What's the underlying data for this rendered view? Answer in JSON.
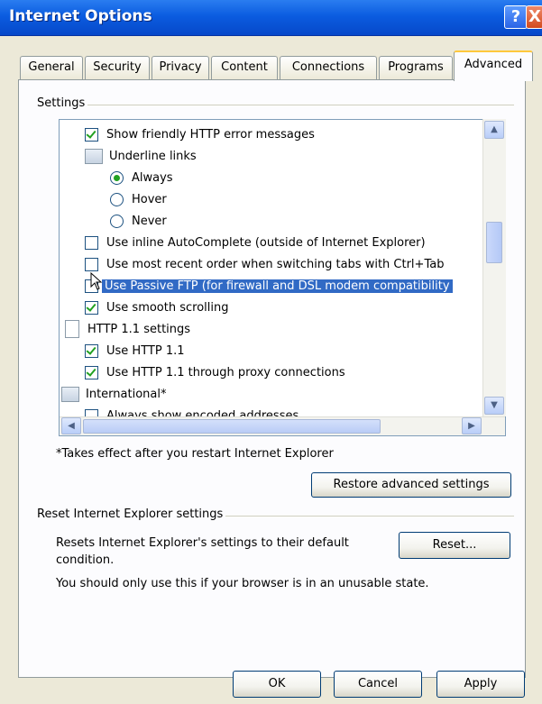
{
  "window": {
    "title": "Internet Options"
  },
  "titlebar_buttons": {
    "help": "?",
    "close": "X"
  },
  "tabs": [
    {
      "label": "General"
    },
    {
      "label": "Security"
    },
    {
      "label": "Privacy"
    },
    {
      "label": "Content"
    },
    {
      "label": "Connections"
    },
    {
      "label": "Programs"
    },
    {
      "label": "Advanced",
      "active": true
    }
  ],
  "settings": {
    "group_label": "Settings",
    "items": [
      {
        "type": "checkbox",
        "checked": true,
        "label": "Show friendly HTTP error messages"
      },
      {
        "type": "category",
        "label": "Underline links"
      },
      {
        "type": "radio",
        "checked": true,
        "label": "Always"
      },
      {
        "type": "radio",
        "checked": false,
        "label": "Hover"
      },
      {
        "type": "radio",
        "checked": false,
        "label": "Never"
      },
      {
        "type": "checkbox",
        "checked": false,
        "label": "Use inline AutoComplete (outside of Internet Explorer)"
      },
      {
        "type": "checkbox",
        "checked": false,
        "label": "Use most recent order when switching tabs with Ctrl+Tab"
      },
      {
        "type": "checkbox",
        "checked": false,
        "selected": true,
        "label": "Use Passive FTP (for firewall and DSL modem compatibility"
      },
      {
        "type": "checkbox",
        "checked": true,
        "label": "Use smooth scrolling"
      },
      {
        "type": "page",
        "label": "HTTP 1.1 settings"
      },
      {
        "type": "checkbox",
        "checked": true,
        "label": "Use HTTP 1.1"
      },
      {
        "type": "checkbox",
        "checked": true,
        "label": "Use HTTP 1.1 through proxy connections"
      },
      {
        "type": "category",
        "label": "International*"
      },
      {
        "type": "checkbox",
        "checked": false,
        "label": "Always show encoded addresses"
      }
    ],
    "footnote": "*Takes effect after you restart Internet Explorer",
    "restore_button": "Restore advanced settings"
  },
  "reset_section": {
    "group_label": "Reset Internet Explorer settings",
    "description": "Resets Internet Explorer's settings to their default condition.",
    "reset_button": "Reset...",
    "warning": "You should only use this if your browser is in an unusable state."
  },
  "footer_buttons": {
    "ok": "OK",
    "cancel": "Cancel",
    "apply": "Apply"
  },
  "colors": {
    "title_bar": "#0b5ce0",
    "selection": "#316ac5",
    "check": "#21a121",
    "dialog_bg": "#ece9d8"
  }
}
